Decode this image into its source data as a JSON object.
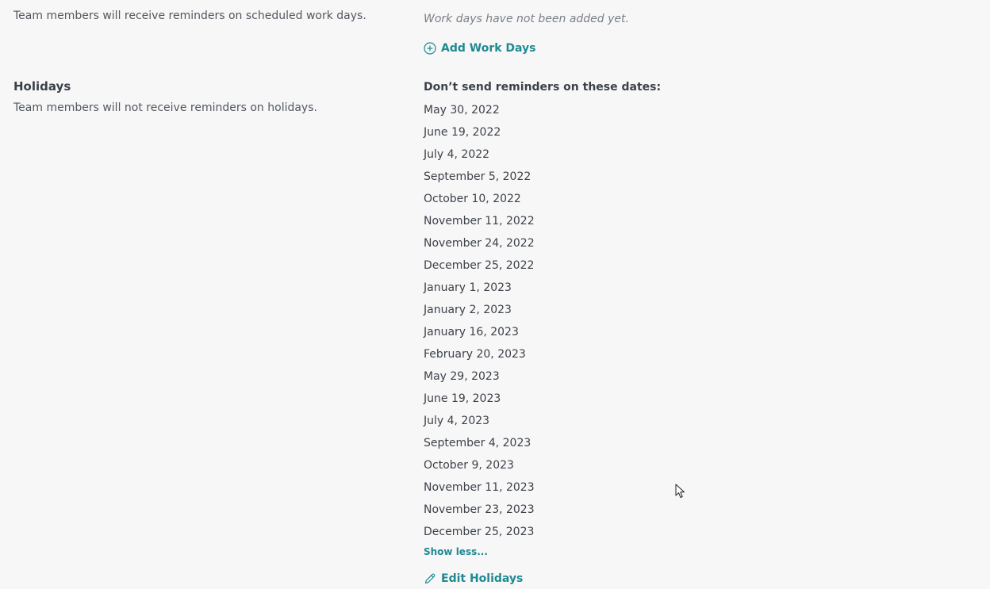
{
  "work_days": {
    "description": "Team members will receive reminders on scheduled work days.",
    "empty_note": "Work days have not been added yet.",
    "add_label": "Add Work Days"
  },
  "holidays": {
    "title": "Holidays",
    "description": "Team members will not receive reminders on holidays.",
    "dates_title": "Don’t send reminders on these dates:",
    "dates": [
      "May 30, 2022",
      "June 19, 2022",
      "July 4, 2022",
      "September 5, 2022",
      "October 10, 2022",
      "November 11, 2022",
      "November 24, 2022",
      "December 25, 2022",
      "January 1, 2023",
      "January 2, 2023",
      "January 16, 2023",
      "February 20, 2023",
      "May 29, 2023",
      "June 19, 2023",
      "July 4, 2023",
      "September 4, 2023",
      "October 9, 2023",
      "November 11, 2023",
      "November 23, 2023",
      "December 25, 2023"
    ],
    "show_less_label": "Show less...",
    "edit_label": "Edit Holidays"
  },
  "icons": {
    "add": "plus-circle-icon",
    "edit": "pencil-icon"
  },
  "colors": {
    "accent": "#1f8a92",
    "background": "#f7f7f7",
    "text": "#3c4149"
  }
}
